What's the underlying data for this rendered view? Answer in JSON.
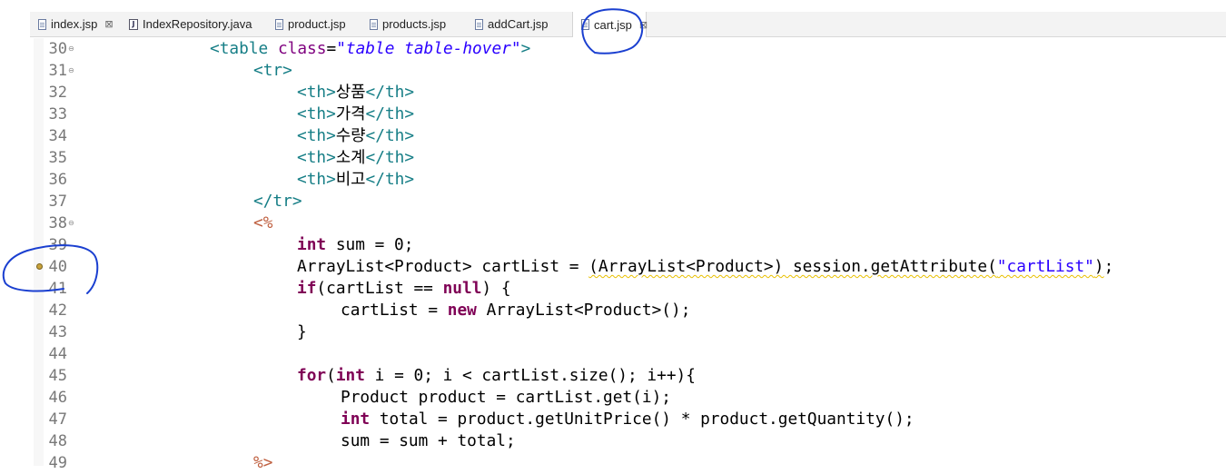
{
  "tabs": [
    {
      "label": "index.jsp",
      "icon": "jsp-file-icon",
      "closable": true
    },
    {
      "label": "IndexRepository.java",
      "icon": "java-file-icon",
      "closable": false
    },
    {
      "label": "product.jsp",
      "icon": "jsp-file-icon",
      "closable": false
    },
    {
      "label": "products.jsp",
      "icon": "jsp-file-icon",
      "closable": false
    },
    {
      "label": "addCart.jsp",
      "icon": "jsp-file-icon",
      "closable": false
    },
    {
      "label": "cart.jsp",
      "icon": "jsp-file-icon",
      "closable": true,
      "active": true
    }
  ],
  "java_icon_glyph": "J",
  "close_glyph": "⊠",
  "fold_glyph": "⊖",
  "editor": {
    "lines": [
      {
        "n": "30",
        "tokens": [
          [
            "tag",
            "<table "
          ],
          [
            "attr",
            "class"
          ],
          [
            "txt",
            "="
          ],
          [
            "str",
            "\"table table-hover\""
          ],
          [
            "tag",
            ">"
          ]
        ]
      },
      {
        "n": "31",
        "tokens": [
          [
            "tag",
            "<tr>"
          ]
        ]
      },
      {
        "n": "32",
        "tokens": [
          [
            "tag",
            "<th>"
          ],
          [
            "txt",
            "상품"
          ],
          [
            "tag",
            "</th>"
          ]
        ]
      },
      {
        "n": "33",
        "tokens": [
          [
            "tag",
            "<th>"
          ],
          [
            "txt",
            "가격"
          ],
          [
            "tag",
            "</th>"
          ]
        ]
      },
      {
        "n": "34",
        "tokens": [
          [
            "tag",
            "<th>"
          ],
          [
            "txt",
            "수량"
          ],
          [
            "tag",
            "</th>"
          ]
        ]
      },
      {
        "n": "35",
        "tokens": [
          [
            "tag",
            "<th>"
          ],
          [
            "txt",
            "소계"
          ],
          [
            "tag",
            "</th>"
          ]
        ]
      },
      {
        "n": "36",
        "tokens": [
          [
            "tag",
            "<th>"
          ],
          [
            "txt",
            "비고"
          ],
          [
            "tag",
            "</th>"
          ]
        ]
      },
      {
        "n": "37",
        "tokens": [
          [
            "tag",
            "</tr>"
          ]
        ]
      },
      {
        "n": "38",
        "tokens": [
          [
            "delim",
            "<%"
          ]
        ]
      },
      {
        "n": "39",
        "tokens": [
          [
            "kw",
            "int"
          ],
          [
            "txt",
            " sum = 0;"
          ]
        ]
      },
      {
        "n": "40",
        "tokens": [
          [
            "txt",
            "ArrayList<Product> cartList = "
          ],
          [
            "squig",
            "(ArrayList<Product>) session.getAttribute("
          ],
          [
            "sjstr",
            "\"cartList\""
          ],
          [
            "squig",
            ")"
          ],
          [
            "txt",
            ";"
          ]
        ]
      },
      {
        "n": "41",
        "tokens": [
          [
            "kw",
            "if"
          ],
          [
            "txt",
            "(cartList == "
          ],
          [
            "kw",
            "null"
          ],
          [
            "txt",
            ") {"
          ]
        ]
      },
      {
        "n": "42",
        "tokens": [
          [
            "txt",
            "cartList = "
          ],
          [
            "kw",
            "new"
          ],
          [
            "txt",
            " ArrayList<Product>();"
          ]
        ]
      },
      {
        "n": "43",
        "tokens": [
          [
            "txt",
            "}"
          ]
        ]
      },
      {
        "n": "44",
        "tokens": []
      },
      {
        "n": "45",
        "tokens": [
          [
            "kw",
            "for"
          ],
          [
            "txt",
            "("
          ],
          [
            "kw",
            "int"
          ],
          [
            "txt",
            " i = 0; i < cartList.size(); i++){"
          ]
        ]
      },
      {
        "n": "46",
        "tokens": [
          [
            "txt",
            "Product product = cartList.get(i);"
          ]
        ]
      },
      {
        "n": "47",
        "tokens": [
          [
            "kw",
            "int"
          ],
          [
            "txt",
            " total = product.getUnitPrice() * product.getQuantity();"
          ]
        ]
      },
      {
        "n": "48",
        "tokens": [
          [
            "txt",
            "sum = sum + total;"
          ]
        ]
      },
      {
        "n": "49",
        "tokens": [
          [
            "delim",
            "%>"
          ]
        ]
      }
    ]
  }
}
